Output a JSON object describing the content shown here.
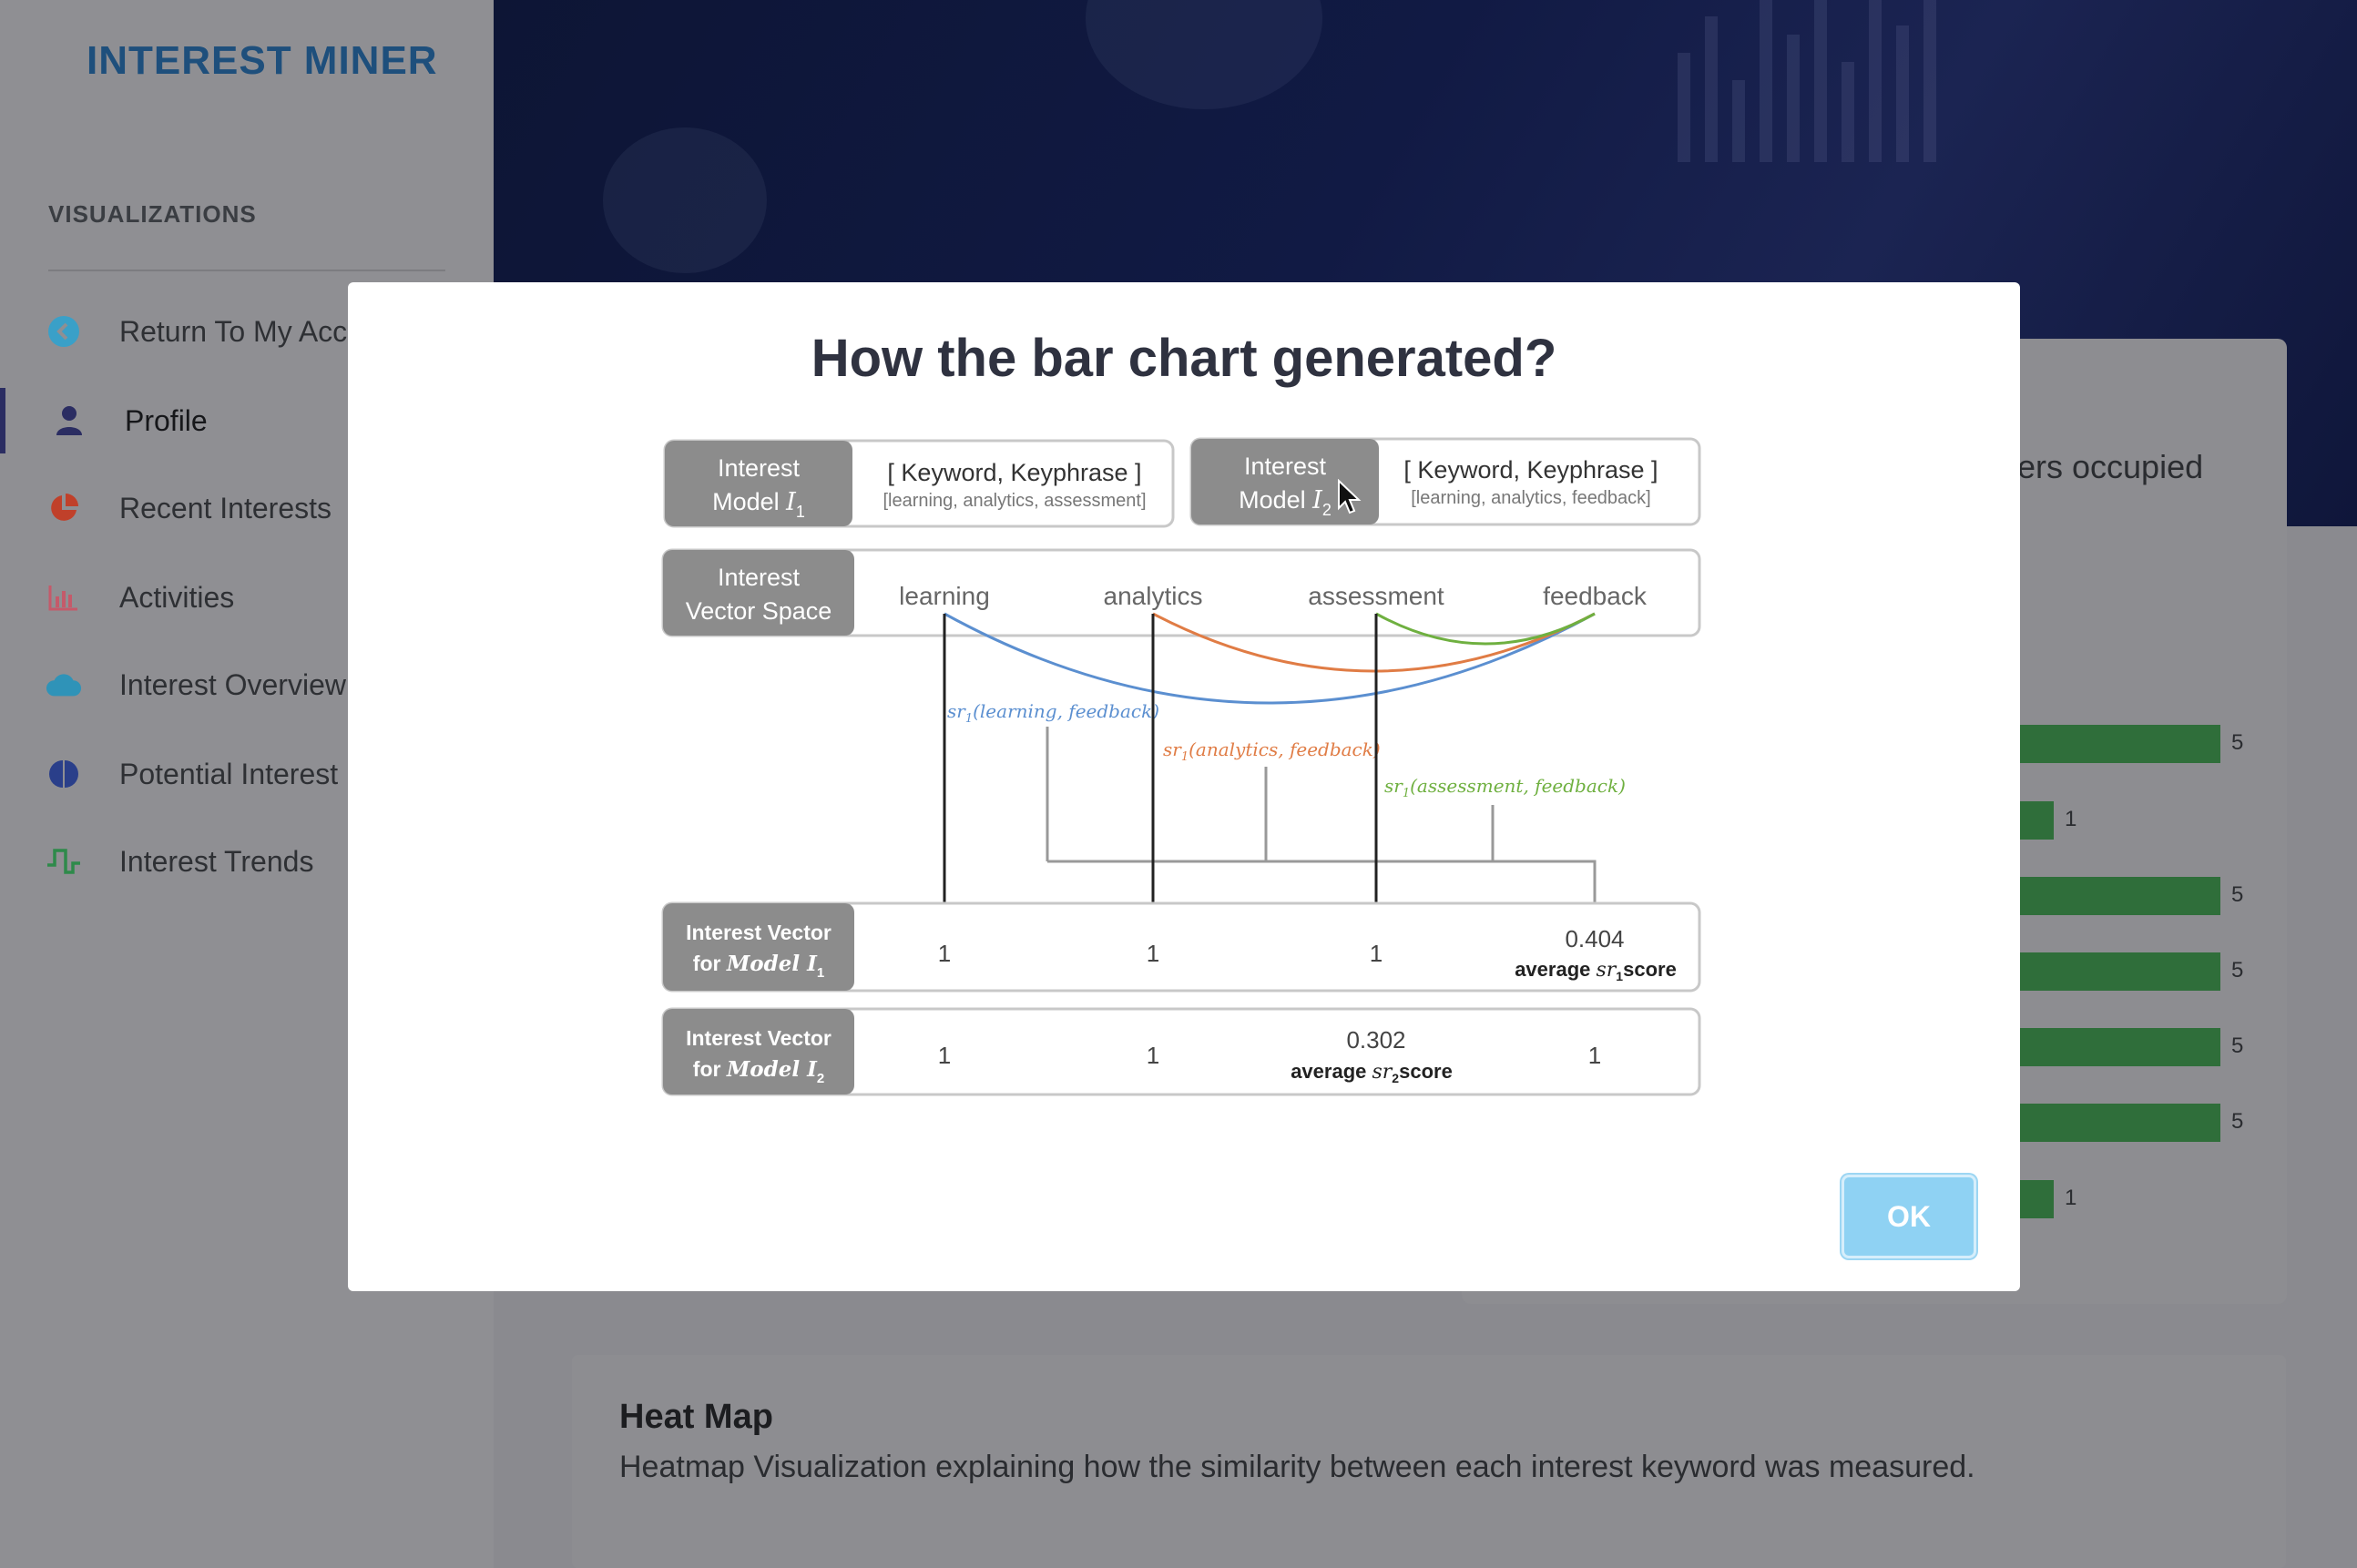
{
  "sidebar": {
    "brand": "INTEREST MINER",
    "section_heading": "VISUALIZATIONS",
    "items": [
      {
        "label": "Return To My Acc",
        "icon": "chevron-left-circle-icon",
        "color": "#3aa0c8"
      },
      {
        "label": "Profile",
        "icon": "user-icon",
        "color": "#2b2d62"
      },
      {
        "label": "Recent Interests",
        "icon": "pie-chart-icon",
        "color": "#c0402a"
      },
      {
        "label": "Activities",
        "icon": "bar-chart-icon",
        "color": "#c55a6a"
      },
      {
        "label": "Interest Overview",
        "icon": "cloud-icon",
        "color": "#2f93b8"
      },
      {
        "label": "Potential Interest",
        "icon": "brain-icon",
        "color": "#2a3f8a"
      },
      {
        "label": "Interest Trends",
        "icon": "pulse-icon",
        "color": "#2e8a4a"
      }
    ]
  },
  "background": {
    "right_card_text": "ers occupied",
    "bar_labels": [
      "5",
      "1",
      "5",
      "5",
      "5",
      "5",
      "1"
    ],
    "bar_values": [
      5,
      1,
      5,
      5,
      5,
      5,
      1
    ],
    "heatmap": {
      "title": "Heat Map",
      "description": "Heatmap Visualization explaining how the similarity between each interest keyword was measured."
    }
  },
  "modal": {
    "title": "How the bar chart generated?",
    "ok_label": "OK",
    "diagram": {
      "model1": {
        "label_line1": "Interest",
        "label_line2": "Model ",
        "label_symbol": "I",
        "label_sub": "1",
        "keywords_title": "[ Keyword, Keyphrase ]",
        "keywords": "[learning, analytics, assessment]"
      },
      "model2": {
        "label_line1": "Interest",
        "label_line2": "Model ",
        "label_symbol": "I",
        "label_sub": "2",
        "keywords_title": "[ Keyword, Keyphrase ]",
        "keywords": "[learning, analytics, feedback]"
      },
      "vector_space": {
        "label_line1": "Interest",
        "label_line2": "Vector Space",
        "terms": [
          "learning",
          "analytics",
          "assessment",
          "feedback"
        ]
      },
      "similarities": [
        {
          "prefix": "sr",
          "sub": "1",
          "args": "(learning, feedback)",
          "color": "#5b8fd0"
        },
        {
          "prefix": "sr",
          "sub": "1",
          "args": "(analytics, feedback)",
          "color": "#e07c45"
        },
        {
          "prefix": "sr",
          "sub": "1",
          "args": "(assessment, feedback)",
          "color": "#6fb040"
        }
      ],
      "vector1": {
        "label_line1": "Interest Vector",
        "label_line2": "for ",
        "label_model": "Model I",
        "label_sub": "1",
        "values": [
          "1",
          "1",
          "1",
          "0.404"
        ],
        "score_note": "average ",
        "score_symbol": "sr",
        "score_sub": "1",
        "score_suffix": "score"
      },
      "vector2": {
        "label_line1": "Interest Vector",
        "label_line2": "for ",
        "label_model": "Model I",
        "label_sub": "2",
        "values": [
          "1",
          "1",
          "0.302",
          "1"
        ],
        "score_note": "average ",
        "score_symbol": "sr",
        "score_sub": "2",
        "score_suffix": "score"
      }
    }
  },
  "colors": {
    "brand": "#1e4f7c",
    "modal_label_bg": "#8c8c8c",
    "ok_button": "#8fd2f3",
    "bar_green": "#2f6e3a"
  }
}
